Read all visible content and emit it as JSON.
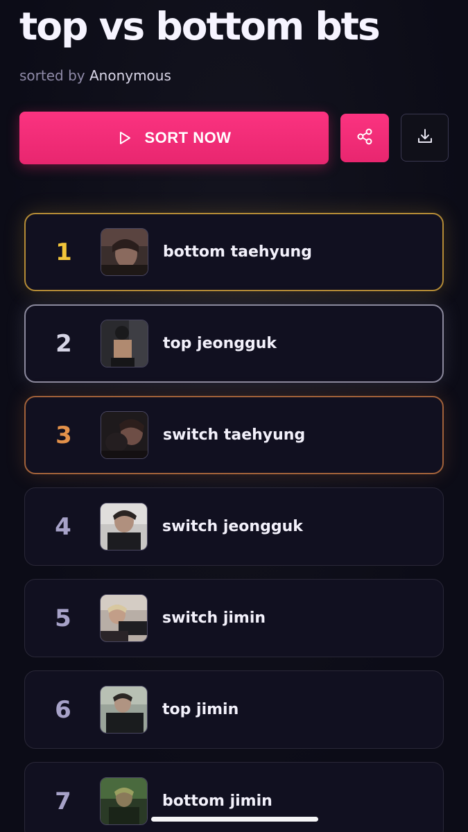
{
  "header": {
    "title": "top vs bottom bts",
    "sorted_by_prefix": "sorted by",
    "author": "Anonymous"
  },
  "actions": {
    "sort_label": "SORT NOW",
    "sort_icon": "play-icon",
    "share_icon": "share-icon",
    "download_icon": "download-icon"
  },
  "colors": {
    "accent": "#f72d78",
    "gold": "#f2c53a",
    "silver": "#d6d5e6",
    "bronze": "#e3914a",
    "background": "#0c0c18"
  },
  "ranking": [
    {
      "rank": "1",
      "name": "bottom taehyung",
      "tier": "gold"
    },
    {
      "rank": "2",
      "name": "top jeongguk",
      "tier": "silver"
    },
    {
      "rank": "3",
      "name": "switch taehyung",
      "tier": "bronze"
    },
    {
      "rank": "4",
      "name": "switch jeongguk",
      "tier": "normal"
    },
    {
      "rank": "5",
      "name": "switch jimin",
      "tier": "normal"
    },
    {
      "rank": "6",
      "name": "top jimin",
      "tier": "normal"
    },
    {
      "rank": "7",
      "name": "bottom jimin",
      "tier": "normal"
    }
  ]
}
